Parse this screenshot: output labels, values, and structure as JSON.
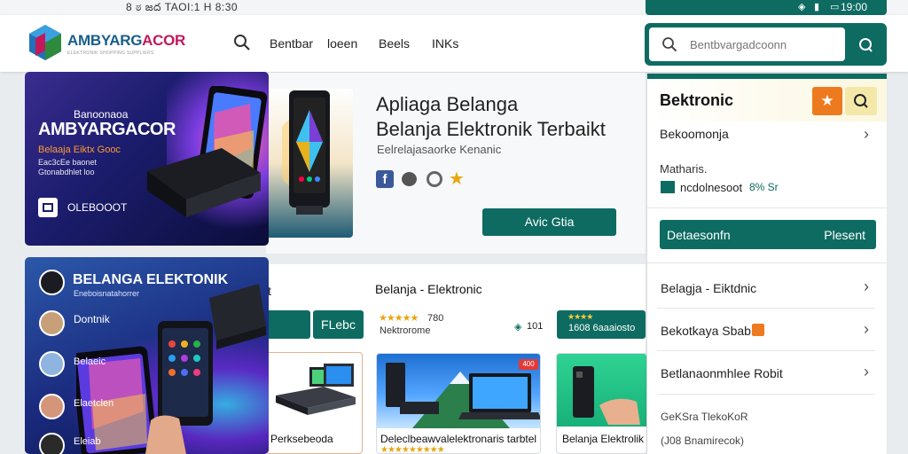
{
  "statusbar": {
    "left_text": "8 ಠ జద TAOI:1 H 8:30",
    "time": "19:00"
  },
  "brand": {
    "name_a": "AMBYARG",
    "name_b": "ACOR",
    "tagline": "ELEKTRONIK SHOPPING SUPPLIERS"
  },
  "nav": {
    "links": [
      "Bentbar",
      "loeen",
      "Beels",
      "INKs"
    ]
  },
  "search": {
    "placeholder": "Bentbvargadcoonn"
  },
  "panel": {
    "title": "Bektronic",
    "row1": "Bekoomonja",
    "note_label": "Matharis.",
    "note_value": "ncdolnesoot",
    "note_badge": "8% Sr",
    "btn_left": "Detaesonfn",
    "btn_right": "Plesent",
    "items": [
      "Belagja - Eiktdnic",
      "Bekotkaya Sbabl",
      "Betlanaonmhlee Robit"
    ],
    "footer1": "GeKSra TlekoKoR",
    "footer2": "(J08 Bnamirecok)"
  },
  "promo1": {
    "top": "Banoonaoa",
    "brand": "AMBYARGACOR",
    "sub": "Belaaja Eiktx Gooc",
    "line1": "Eac3cEe baonet",
    "line2": "Gtonabdhlet loo",
    "cta": "OLEBOOOT"
  },
  "hero": {
    "title1": "Apliaga Belanga",
    "title2": "Belanja Elektronik Terbaikt",
    "sub": "Eelrelajasaorke Kenanic",
    "cta": "Avic Gtia"
  },
  "promo2": {
    "title": "BELANGA ELEKTONIK",
    "sub": "Eneboisnatahorrer",
    "label1": "Dontnik",
    "label2": "Belaeic",
    "label3": "Elaetclen",
    "label4": "Eleiab"
  },
  "section2": {
    "title": "Belanja - Elektronic",
    "sort_left": "t",
    "filter": "FLebc",
    "rating_count": "780",
    "rating_label": "Nektrorome",
    "price": "101",
    "price_pill": "1608 6aaaiosto",
    "card1": "Perksebeoda",
    "card2": "Deleclbeawvalelektronaris tarbtel",
    "card3": "Belanja Elektrolik",
    "badge": "400"
  },
  "colors": {
    "teal": "#0e6b62",
    "orange": "#ee7a1f",
    "navy": "#1c1d6e"
  }
}
